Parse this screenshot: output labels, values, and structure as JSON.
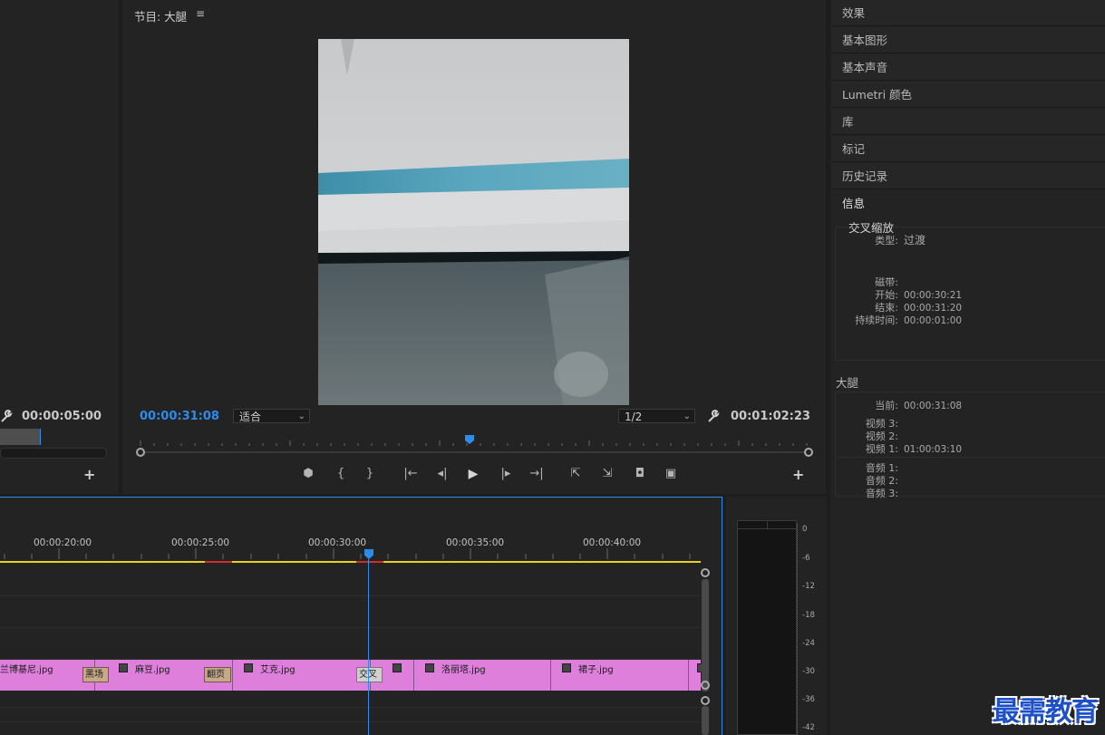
{
  "source_panel": {
    "timecode": "00:00:05:00",
    "add_label": "+"
  },
  "program_monitor": {
    "title": "节目: 大腿",
    "menu_glyph": "≡",
    "current_timecode": "00:00:31:08",
    "zoom_select": "适合",
    "resolution_select": "1/2",
    "duration_timecode": "00:01:02:23",
    "add_label": "+",
    "controls": {
      "marker": "⬢",
      "mark_in": "{",
      "mark_out": "}",
      "go_in": "|←",
      "step_back": "◂|",
      "play": "▶",
      "step_fwd": "|▸",
      "go_out": "→|",
      "lift": "⇱",
      "extract": "⇲",
      "export_frame": "◘",
      "compare": "▣"
    }
  },
  "right_panel": {
    "items": [
      "效果",
      "基本图形",
      "基本声音",
      "Lumetri 颜色",
      "库",
      "标记",
      "历史记录"
    ],
    "info_tab": "信息",
    "info": {
      "item_name": "交叉缩放",
      "type_key": "类型:",
      "type_val": "过渡",
      "tape_key": "磁带:",
      "start_key": "开始:",
      "start_val": "00:00:30:21",
      "end_key": "结束:",
      "end_val": "00:00:31:20",
      "dur_key": "持续时间:",
      "dur_val": "00:00:01:00"
    },
    "seq_name": "大腿",
    "seq": {
      "current_key": "当前:",
      "current_val": "00:00:31:08",
      "v3_key": "视频 3:",
      "v2_key": "视频 2:",
      "v1_key": "视频 1:",
      "v1_val": "01:00:03:10",
      "a1_key": "音频 1:",
      "a2_key": "音频 2:",
      "a3_key": "音频 3:"
    }
  },
  "timeline": {
    "ruler": [
      "00:00:20:00",
      "00:00:25:00",
      "00:00:30:00",
      "00:00:35:00",
      "00:00:40:00"
    ],
    "clips": [
      "兰博基尼.jpg",
      "麻豆.jpg",
      "艾克.jpg",
      "",
      "洛丽塔.jpg",
      "裙子.jpg"
    ],
    "transitions": [
      "黑场",
      "翻页",
      "交叉"
    ]
  },
  "audio_meter": {
    "labels": [
      "0",
      "-6",
      "-12",
      "-18",
      "-24",
      "-30",
      "-36",
      "-42"
    ]
  },
  "watermark": "最需教育",
  "colors": {
    "accent_blue": "#2d8ceb",
    "clip_pink": "#df7fdc",
    "work_area_yellow": "#e8d21d",
    "render_red": "#d42b2b"
  }
}
